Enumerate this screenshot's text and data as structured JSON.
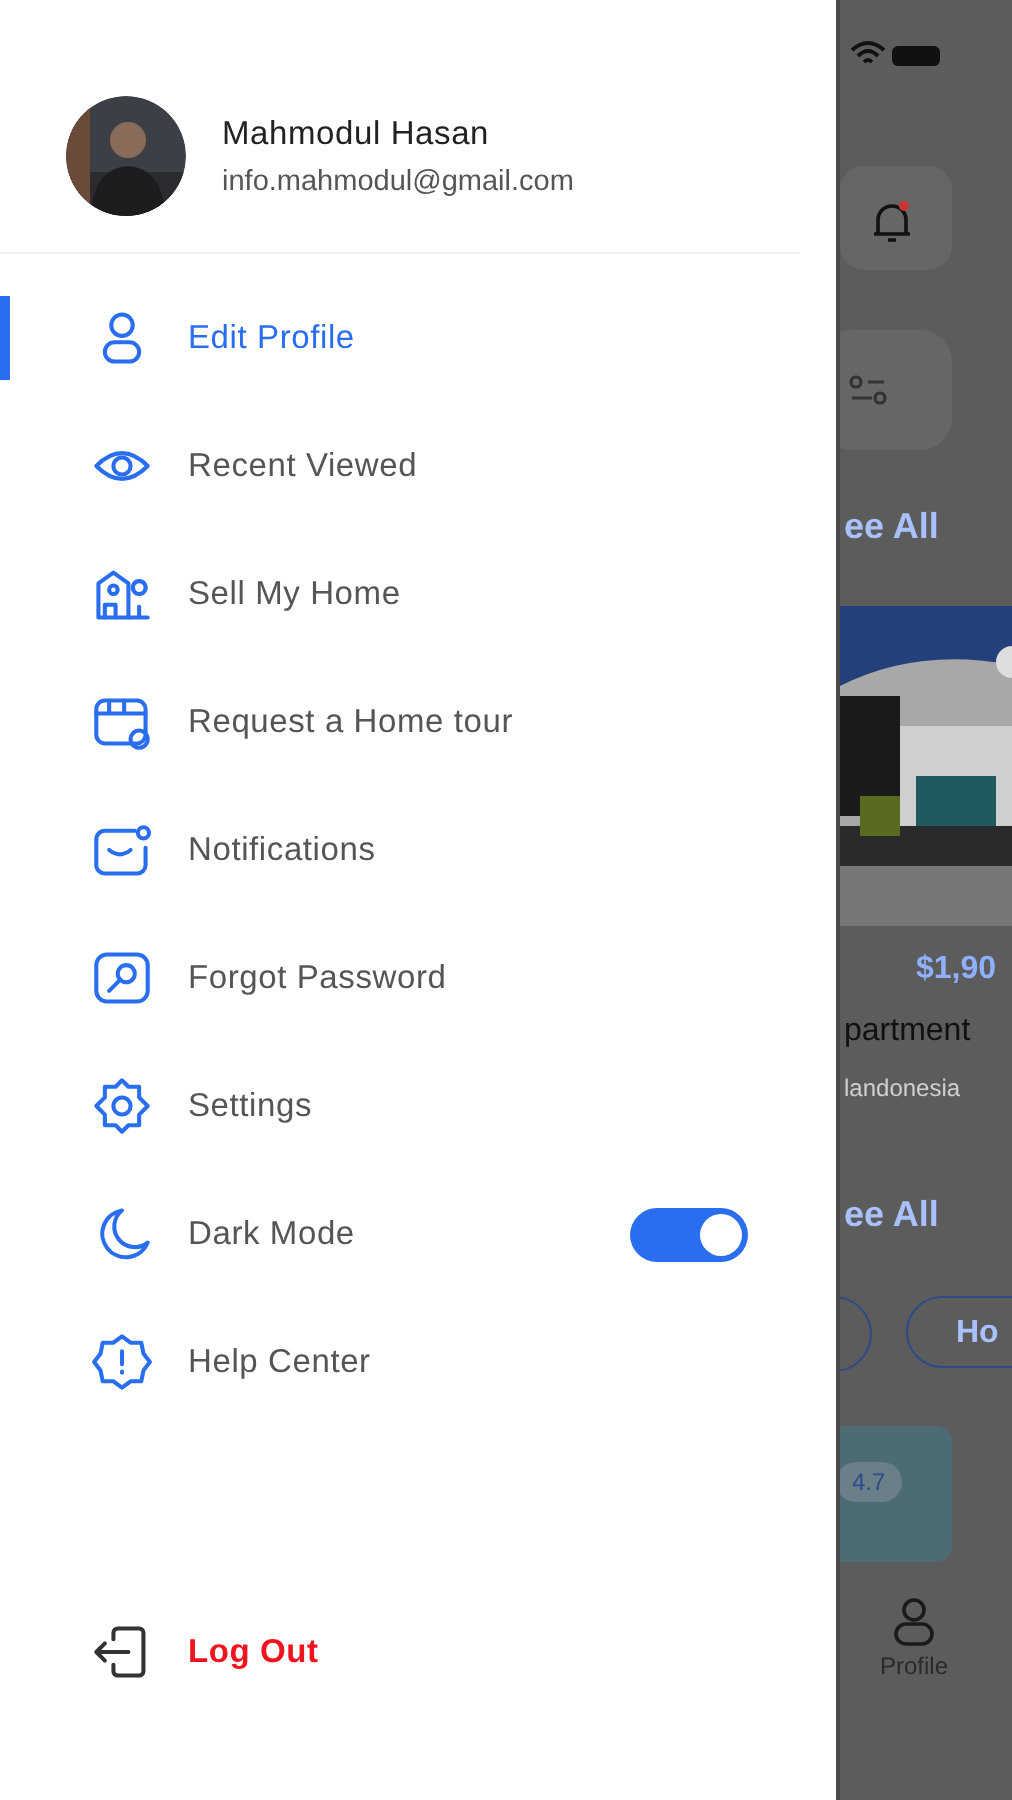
{
  "drawer": {
    "profile": {
      "name": "Mahmodul Hasan",
      "email": "info.mahmodul@gmail.com"
    },
    "menu": [
      {
        "label": "Edit Profile",
        "kind": "link",
        "selected": true
      },
      {
        "label": "Recent Viewed",
        "kind": "link",
        "selected": false
      },
      {
        "label": "Sell My Home",
        "kind": "link",
        "selected": false
      },
      {
        "label": "Request a Home tour",
        "kind": "link",
        "selected": false
      },
      {
        "label": "Notifications",
        "kind": "link",
        "selected": false
      },
      {
        "label": "Forgot Password",
        "kind": "link",
        "selected": false
      },
      {
        "label": "Settings",
        "kind": "link",
        "selected": false
      },
      {
        "label": "Dark Mode",
        "kind": "toggle",
        "selected": false,
        "on": true
      },
      {
        "label": "Help Center",
        "kind": "link",
        "selected": false
      }
    ],
    "logout": {
      "label": "Log Out"
    }
  },
  "background_screen": {
    "see_all": [
      "ee All",
      "ee All"
    ],
    "price": "$1,90",
    "title": "partment",
    "location": "landonesia",
    "chip": "Ho",
    "rating": "4.7",
    "nav_tab": "Profile"
  }
}
